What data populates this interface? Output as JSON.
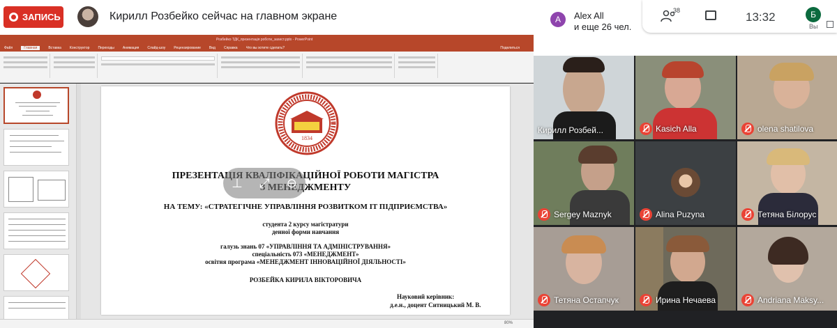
{
  "recording": {
    "label": "ЗАПИСЬ"
  },
  "presenter": {
    "text": "Кирилл Розбейко сейчас на главном экране"
  },
  "powerpoint": {
    "window_title": "Розбейко ТДК_презентація роботи_захист.pptx - PowerPoint",
    "tabs": [
      "Файл",
      "Главная",
      "Вставка",
      "Конструктор",
      "Переходы",
      "Анимация",
      "Слайд-шоу",
      "Рецензирование",
      "Вид",
      "Справка",
      "Что вы хотите сделать?"
    ],
    "share": "Поделиться",
    "slide_numbers": [
      "1",
      "2",
      "3",
      "4",
      "5",
      "6"
    ],
    "status_zoom": "80%"
  },
  "slide": {
    "title_line1": "ПРЕЗЕНТАЦІЯ КВАЛІФІКАЦІЙНОЇ РОБОТИ МАГІСТРА",
    "title_line2": "З МЕНЕДЖМЕНТУ",
    "topic": "НА ТЕМУ: «СТРАТЕГІЧНЕ УПРАВЛІННЯ РОЗВИТКОМ IT ПІДПРИЄМСТВА»",
    "student_line1": "студента 2 курсу магістратури",
    "student_line2": "денної форми навчання",
    "field1": "галузь знань 07 «УПРАВЛІННЯ ТА АДМІНІСТРУВАННЯ»",
    "field2": "спеціальність 073 «МЕНЕДЖМЕНТ»",
    "field3": "освітня програма  «МЕНЕДЖМЕНТ ІННОВАЦІЙНОЇ ДІЯЛЬНОСТІ»",
    "author": "РОЗБЕЙКА КИРИЛА ВІКТОРОВИЧА",
    "supervisor_label": "Науковий керівник:",
    "supervisor_name": "д.е.н., доцент Ситницький М. В.",
    "seal_text_top": "КИЇВСЬКИЙ НАЦІОНАЛЬНИЙ УНІВЕРСИТЕТ",
    "seal_text_bottom": "ІМЕНІ ТАРАСА ШЕВЧЕНКА",
    "seal_year": "1834"
  },
  "meet": {
    "participant_initial": "A",
    "participant_name": "Alex All",
    "participant_more": "и еще 26 чел.",
    "people_count": "38",
    "time": "13:32",
    "self_initial": "Б",
    "self_label": "Вы"
  },
  "tiles": [
    {
      "name": "Кирилл Розбей...",
      "muted": false
    },
    {
      "name": "Kasich Alla",
      "muted": true
    },
    {
      "name": "olena shatilova",
      "muted": true
    },
    {
      "name": "Sergey Maznyk",
      "muted": true
    },
    {
      "name": "Alina Puzyna",
      "muted": true
    },
    {
      "name": "Тетяна Білорус",
      "muted": true
    },
    {
      "name": "Тетяна Остапчук",
      "muted": true
    },
    {
      "name": "Ирина Нечаева",
      "muted": true
    },
    {
      "name": "Andriana Maksy...",
      "muted": true
    }
  ]
}
